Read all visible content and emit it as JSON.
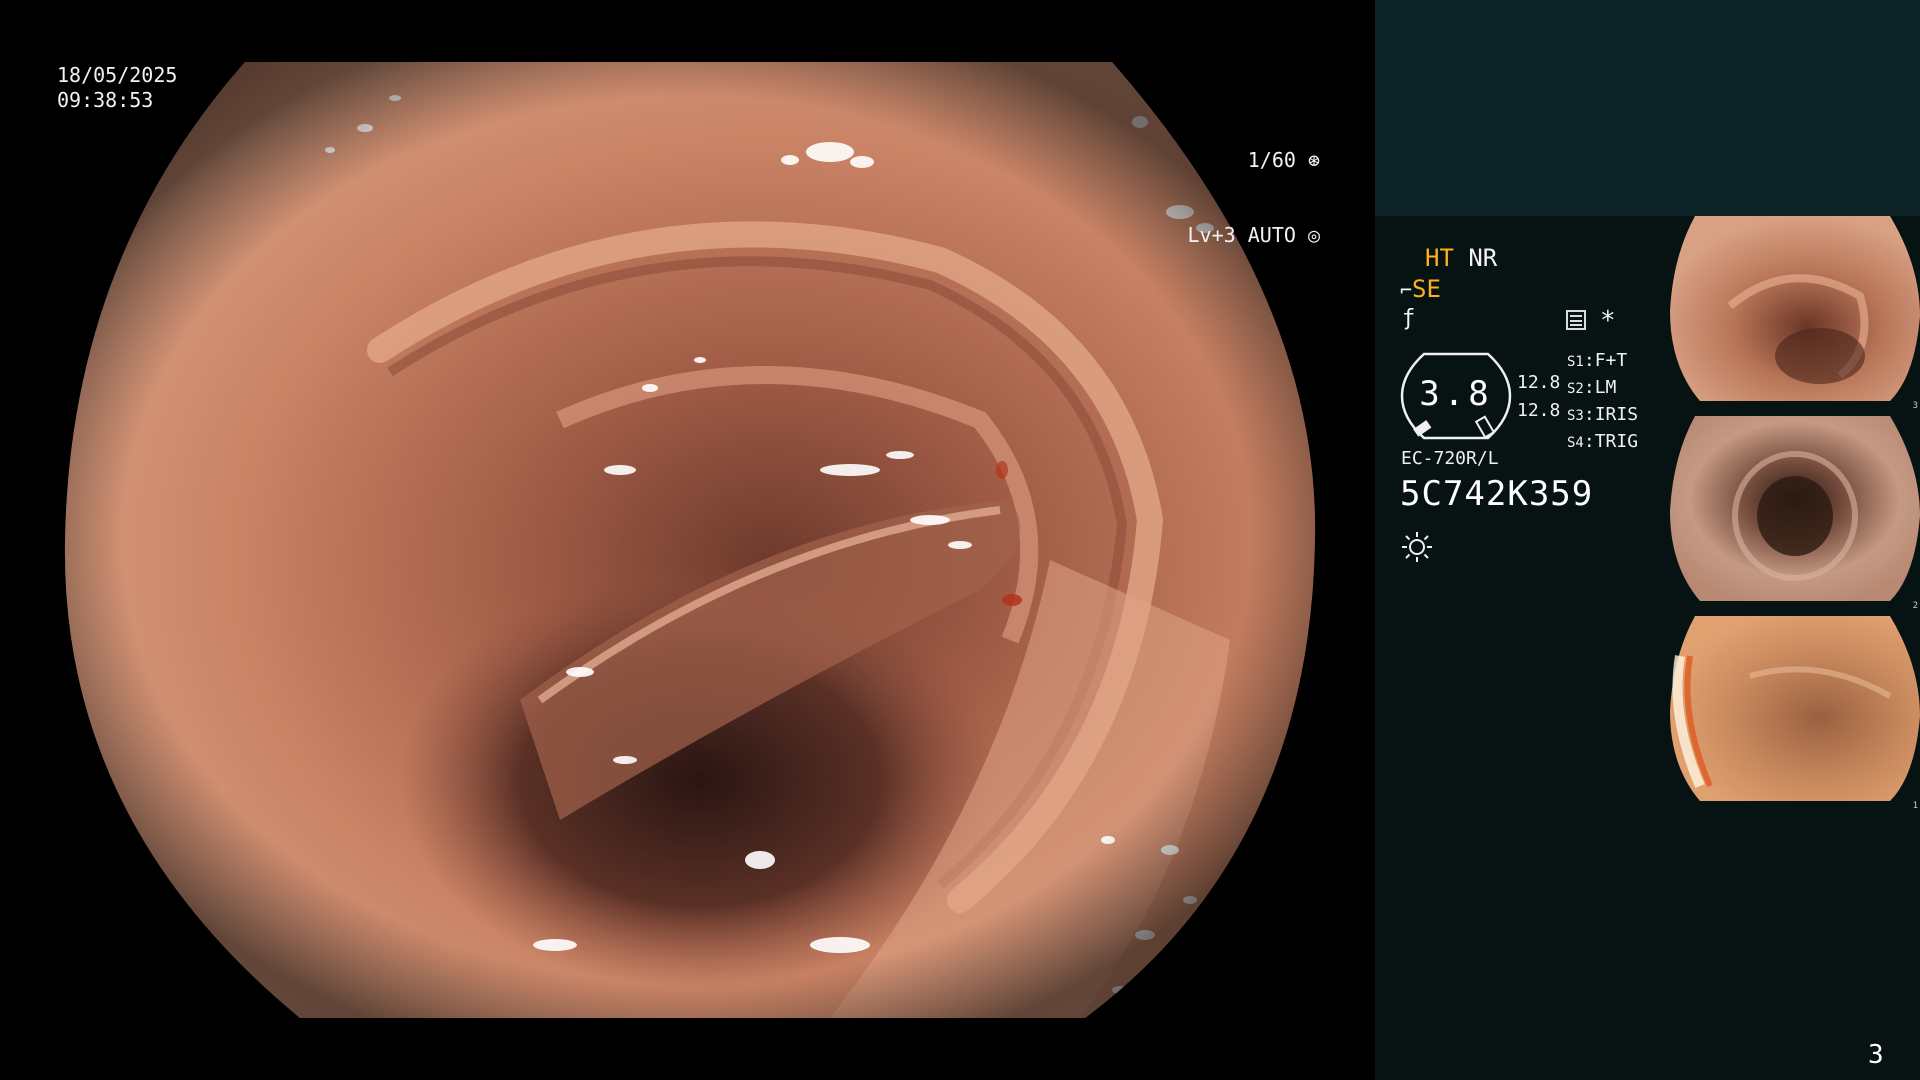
{
  "overlay": {
    "date": "18/05/2025",
    "time": "09:38:53",
    "shutter": "1/60",
    "level": "Lv+3",
    "mode": "AUTO"
  },
  "status": {
    "ht": "HT",
    "nr": "NR",
    "se": "SE",
    "iris_value": "3.8",
    "reading_1": "12.8",
    "reading_2": "12.8",
    "asterisk": "*",
    "switches": [
      {
        "key": "S1",
        "value": "F+T"
      },
      {
        "key": "S2",
        "value": "LM"
      },
      {
        "key": "S3",
        "value": "IRIS"
      },
      {
        "key": "S4",
        "value": "TRIG"
      }
    ]
  },
  "scope": {
    "model": "EC-720R/L",
    "serial": "5C742K359"
  },
  "thumbnails": [
    {
      "index": "3"
    },
    {
      "index": "2"
    },
    {
      "index": "1"
    }
  ],
  "page_number": "3",
  "colors": {
    "accent_yellow": "#ffb01e",
    "panel_top": "#0c2224",
    "panel_bottom": "#061312"
  }
}
